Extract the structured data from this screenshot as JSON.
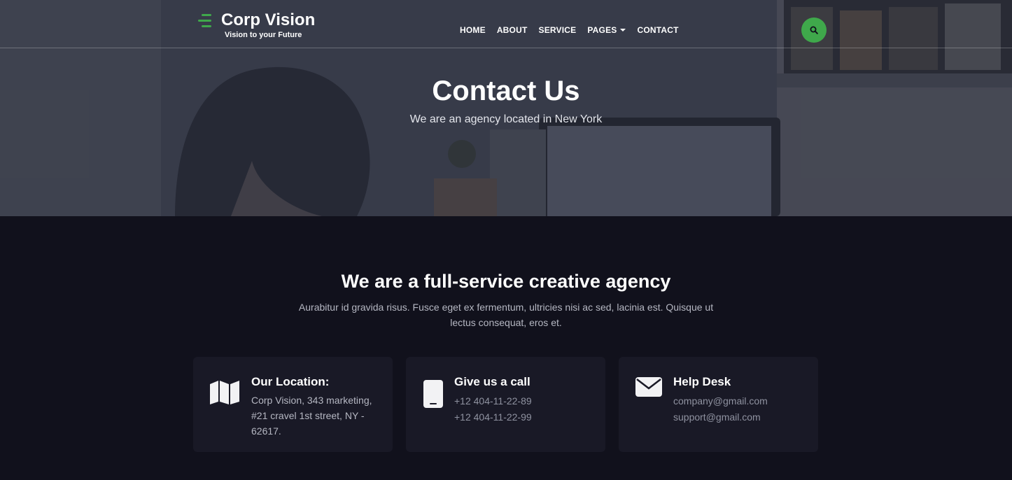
{
  "header": {
    "brand_name": "Corp Vision",
    "brand_tagline": "Vision to your Future",
    "nav": [
      {
        "label": "HOME"
      },
      {
        "label": "ABOUT"
      },
      {
        "label": "SERVICE"
      },
      {
        "label": "PAGES",
        "has_dropdown": true
      },
      {
        "label": "CONTACT"
      }
    ],
    "search_icon": "search-icon",
    "accent_color": "#3fa84b"
  },
  "hero": {
    "title": "Contact Us",
    "subtitle": "We are an agency located in New York"
  },
  "section": {
    "title": "We are a full-service creative agency",
    "text": "Aurabitur id gravida risus. Fusce eget ex fermentum, ultricies nisi ac sed, lacinia est. Quisque ut lectus consequat, eros et."
  },
  "cards": [
    {
      "icon": "map-icon",
      "title": "Our Location:",
      "body": "Corp Vision, 343 marketing, #21 cravel 1st street, NY - 62617."
    },
    {
      "icon": "phone-icon",
      "title": "Give us a call",
      "lines": [
        "+12 404-11-22-89",
        "+12 404-11-22-99"
      ]
    },
    {
      "icon": "envelope-icon",
      "title": "Help Desk",
      "lines": [
        "company@gmail.com",
        "support@gmail.com"
      ]
    }
  ]
}
